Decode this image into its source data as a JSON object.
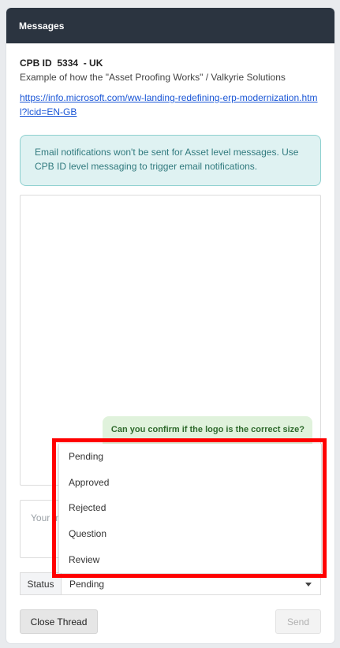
{
  "header": {
    "title": "Messages"
  },
  "cpb": {
    "id_label": "CPB ID",
    "id_value": "5334",
    "region": "- UK",
    "description": "Example of how the \"Asset Proofing Works\" / Valkyrie Solutions",
    "link": "https://info.microsoft.com/ww-landing-redefining-erp-modernization.html?lcid=EN-GB"
  },
  "alert": {
    "text": "Email notifications won't be sent for Asset level messages. Use CPB ID level messaging to trigger email notifications."
  },
  "thread": {
    "messages": [
      {
        "text": "Can you confirm if the logo is the correct size?"
      }
    ]
  },
  "compose": {
    "placeholder": "Your m"
  },
  "status": {
    "label": "Status",
    "selected": "Pending",
    "options": [
      "Pending",
      "Approved",
      "Rejected",
      "Question",
      "Review"
    ]
  },
  "buttons": {
    "close_thread": "Close Thread",
    "send": "Send"
  },
  "colors": {
    "header_bg": "#2b3440",
    "alert_bg": "#dff2f2",
    "bubble_bg": "#e0f2dc",
    "highlight": "#ff0000",
    "link": "#1a56d6"
  }
}
